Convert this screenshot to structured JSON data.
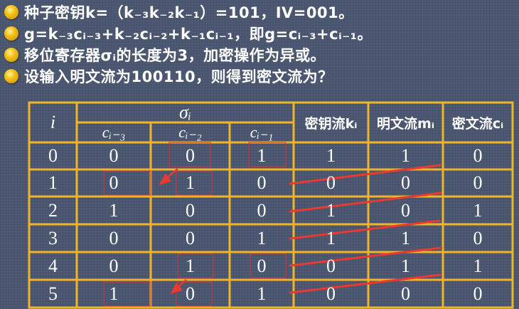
{
  "bullets": [
    "种子密钥k=（k₋₃k₋₂k₋₁）=101，IV=001。",
    "g=k₋₃cᵢ₋₃+k₋₂cᵢ₋₂+k₋₁cᵢ₋₁，即g=cᵢ₋₃+cᵢ₋₁。",
    "移位寄存器σᵢ的长度为3，加密操作为异或。",
    "设输入明文流为100110，则得到密文流为？"
  ],
  "table": {
    "header_i": "i",
    "header_sigma": "σᵢ",
    "sub_headers": [
      "cᵢ₋₃",
      "cᵢ₋₂",
      "cᵢ₋₁"
    ],
    "header_key": "密钥流kᵢ",
    "header_plain": "明文流mᵢ",
    "header_cipher": "密文流cᵢ",
    "rows": [
      [
        "0",
        "0",
        "0",
        "1",
        "1",
        "1",
        "0"
      ],
      [
        "1",
        "0",
        "1",
        "0",
        "0",
        "0",
        "0"
      ],
      [
        "2",
        "1",
        "0",
        "0",
        "1",
        "0",
        "1"
      ],
      [
        "3",
        "0",
        "0",
        "1",
        "1",
        "1",
        "0"
      ],
      [
        "4",
        "0",
        "1",
        "0",
        "0",
        "1",
        "1"
      ],
      [
        "5",
        "1",
        "0",
        "1",
        "0",
        "0",
        "0"
      ]
    ]
  },
  "colors": {
    "grid": "#f0b429",
    "highlight": "#e0302c",
    "arrow": "#e83a30"
  }
}
